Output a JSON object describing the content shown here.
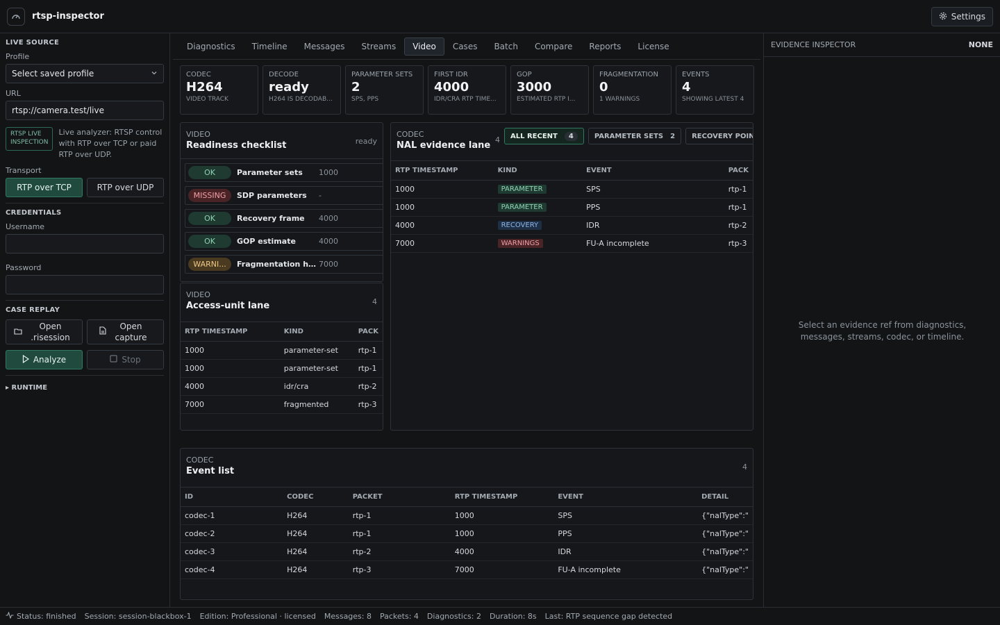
{
  "app": {
    "title": "rtsp-inspector",
    "settings_label": "Settings"
  },
  "left": {
    "live_source": {
      "heading": "LIVE SOURCE",
      "profile_label": "Profile",
      "profile_value": "Select saved profile",
      "url_label": "URL",
      "url_value": "rtsp://camera.test/live",
      "badge": "RTSP LIVE INSPECTION",
      "description": "Live analyzer: RTSP control with RTP over TCP or paid RTP over UDP.",
      "transport_label": "Transport",
      "transport_tcp": "RTP over TCP",
      "transport_udp": "RTP over UDP"
    },
    "credentials": {
      "heading": "CREDENTIALS",
      "username_label": "Username",
      "password_label": "Password"
    },
    "case_replay": {
      "heading": "CASE REPLAY",
      "open_session": "Open .risession",
      "open_capture": "Open capture",
      "analyze": "Analyze",
      "stop": "Stop"
    },
    "runtime": "RUNTIME"
  },
  "tabs": [
    "Diagnostics",
    "Timeline",
    "Messages",
    "Streams",
    "Video",
    "Cases",
    "Batch",
    "Compare",
    "Reports",
    "License"
  ],
  "cards": [
    {
      "key": "CODEC",
      "value": "H264",
      "sub": "VIDEO TRACK"
    },
    {
      "key": "DECODE",
      "value": "ready",
      "sub": "H264 IS DECODAB..."
    },
    {
      "key": "PARAMETER SETS",
      "value": "2",
      "sub": "SPS, PPS"
    },
    {
      "key": "FIRST IDR",
      "value": "4000",
      "sub": "IDR/CRA RTP TIME..."
    },
    {
      "key": "GOP",
      "value": "3000",
      "sub": "ESTIMATED RTP I..."
    },
    {
      "key": "FRAGMENTATION",
      "value": "0",
      "sub": "1 WARNINGS"
    },
    {
      "key": "EVENTS",
      "value": "4",
      "sub": "SHOWING LATEST 4"
    }
  ],
  "readiness": {
    "kind": "VIDEO",
    "title": "Readiness checklist",
    "status": "ready",
    "rows": [
      {
        "state": "OK",
        "name": "Parameter sets",
        "value": "1000"
      },
      {
        "state": "MISSING",
        "name": "SDP parameters",
        "value": "-"
      },
      {
        "state": "OK",
        "name": "Recovery frame",
        "value": "4000"
      },
      {
        "state": "OK",
        "name": "GOP estimate",
        "value": "4000"
      },
      {
        "state": "WARNI...",
        "name": "Fragmentation he...",
        "value": "7000"
      }
    ]
  },
  "access_unit": {
    "kind": "VIDEO",
    "title": "Access-unit lane",
    "count": "4",
    "columns": [
      "RTP TIMESTAMP",
      "KIND",
      "PACK"
    ],
    "rows": [
      [
        "1000",
        "parameter-set",
        "rtp-1"
      ],
      [
        "1000",
        "parameter-set",
        "rtp-1"
      ],
      [
        "4000",
        "idr/cra",
        "rtp-2"
      ],
      [
        "7000",
        "fragmented",
        "rtp-3"
      ]
    ]
  },
  "nal": {
    "kind": "CODEC",
    "title": "NAL evidence lane",
    "count": "4",
    "filters": [
      {
        "label": "ALL RECENT",
        "count": "4"
      },
      {
        "label": "PARAMETER SETS",
        "count": "2"
      },
      {
        "label": "RECOVERY POINTS",
        "count": ""
      }
    ],
    "columns": [
      "RTP TIMESTAMP",
      "KIND",
      "EVENT",
      "PACK"
    ],
    "rows": [
      [
        "1000",
        "PARAMETER",
        "SPS",
        "rtp-1"
      ],
      [
        "1000",
        "PARAMETER",
        "PPS",
        "rtp-1"
      ],
      [
        "4000",
        "RECOVERY",
        "IDR",
        "rtp-2"
      ],
      [
        "7000",
        "WARNINGS",
        "FU-A incomplete",
        "rtp-3"
      ]
    ]
  },
  "events": {
    "kind": "CODEC",
    "title": "Event list",
    "count": "4",
    "columns": [
      "ID",
      "CODEC",
      "PACKET",
      "RTP TIMESTAMP",
      "EVENT",
      "DETAIL"
    ],
    "rows": [
      [
        "codec-1",
        "H264",
        "rtp-1",
        "1000",
        "SPS",
        "{\"nalType\":\""
      ],
      [
        "codec-2",
        "H264",
        "rtp-1",
        "1000",
        "PPS",
        "{\"nalType\":\""
      ],
      [
        "codec-3",
        "H264",
        "rtp-2",
        "4000",
        "IDR",
        "{\"nalType\":\""
      ],
      [
        "codec-4",
        "H264",
        "rtp-3",
        "7000",
        "FU-A incomplete",
        "{\"nalType\":\""
      ]
    ]
  },
  "inspector": {
    "title": "EVIDENCE INSPECTOR",
    "state": "NONE",
    "empty": "Select an evidence ref from diagnostics, messages, streams, codec, or timeline."
  },
  "status": {
    "status": "Status: finished",
    "session": "Session: session-blackbox-1",
    "edition": "Edition: Professional · licensed",
    "messages": "Messages: 8",
    "packets": "Packets: 4",
    "diagnostics": "Diagnostics: 2",
    "duration": "Duration: 8s",
    "last": "Last: RTP sequence gap detected"
  }
}
